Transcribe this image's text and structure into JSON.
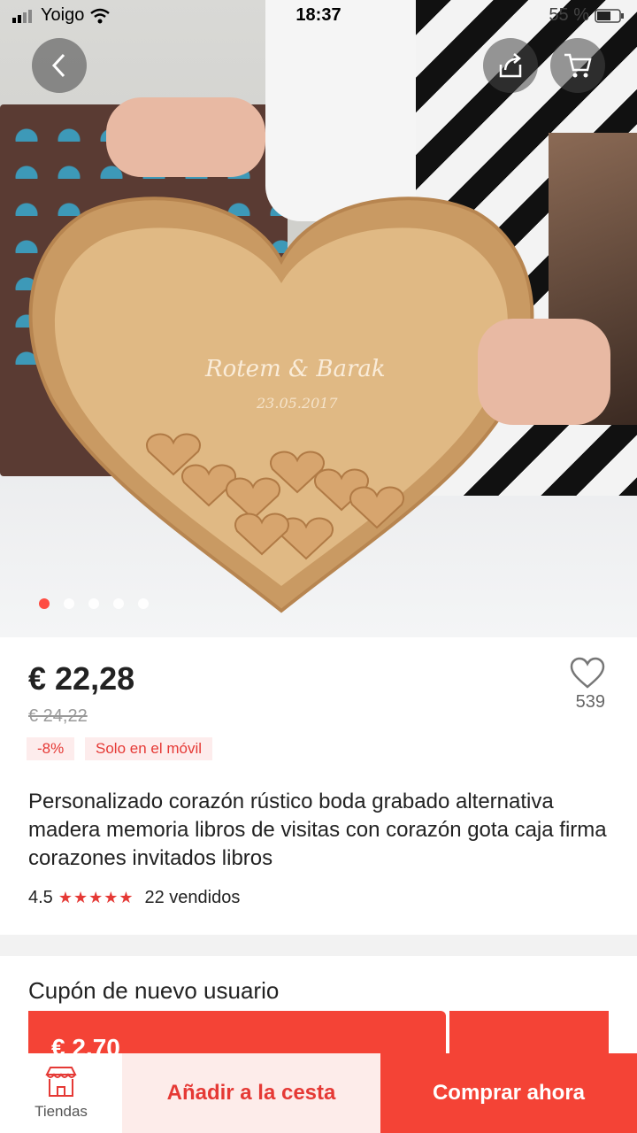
{
  "status_bar": {
    "carrier": "Yoigo",
    "time": "18:37",
    "battery": "55 %"
  },
  "gallery": {
    "slide_count": 5,
    "active_index": 0,
    "photo_engraving": {
      "names": "Rotem & Barak",
      "date": "23.05.2017"
    }
  },
  "product": {
    "price": "€ 22,28",
    "original_price": "€ 24,22",
    "discount_badge": "-8%",
    "mobile_badge": "Solo en el móvil",
    "favorites_count": "539",
    "title": "Personalizado corazón rústico boda grabado alternativa madera memoria libros de visitas con corazón gota caja firma corazones invitados libros",
    "rating": "4.5",
    "stars": "★★★★★",
    "sold": "22 vendidos"
  },
  "coupon": {
    "title": "Cupón de nuevo usuario",
    "value": "€ 2,70"
  },
  "bottom_bar": {
    "shops_label": "Tiendas",
    "add_to_cart": "Añadir a la cesta",
    "buy_now": "Comprar ahora"
  },
  "colors": {
    "accent": "#f44336",
    "accent_light": "#fdecea",
    "price_text": "#222222"
  },
  "icons": [
    "back-icon",
    "share-icon",
    "cart-icon",
    "heart-icon",
    "store-icon",
    "wifi-icon",
    "signal-icon",
    "battery-icon"
  ]
}
